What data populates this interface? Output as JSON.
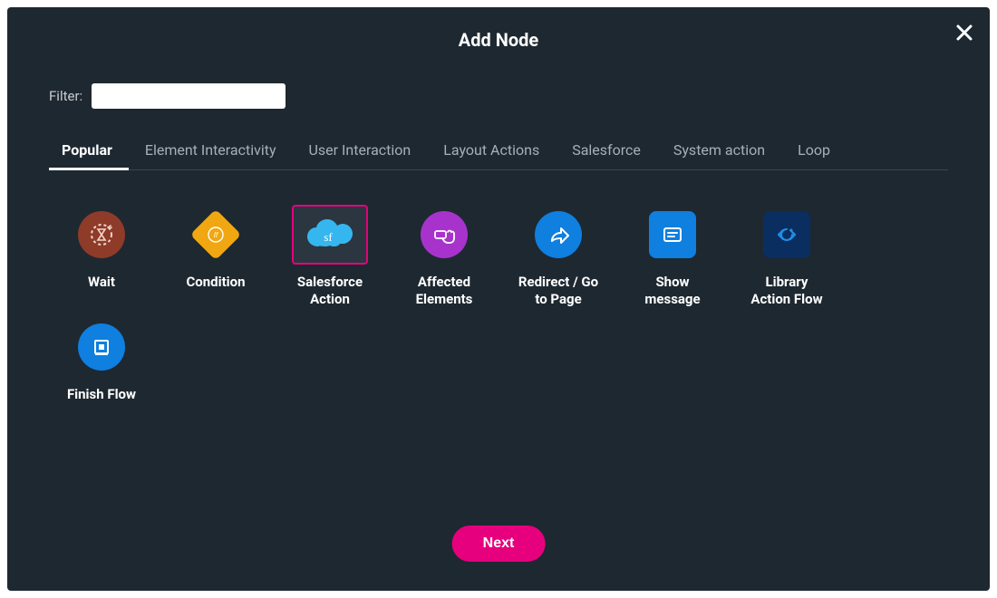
{
  "dialog": {
    "title": "Add Node",
    "filter_label": "Filter:",
    "filter_value": "",
    "filter_placeholder": ""
  },
  "tabs": [
    {
      "label": "Popular",
      "active": true
    },
    {
      "label": "Element Interactivity",
      "active": false
    },
    {
      "label": "User Interaction",
      "active": false
    },
    {
      "label": "Layout Actions",
      "active": false
    },
    {
      "label": "Salesforce",
      "active": false
    },
    {
      "label": "System action",
      "active": false
    },
    {
      "label": "Loop",
      "active": false
    }
  ],
  "nodes": [
    {
      "id": "wait",
      "label": "Wait",
      "selected": false,
      "shape": "circle",
      "bg": "#8e3b2a",
      "icon": "hourglass"
    },
    {
      "id": "condition",
      "label": "Condition",
      "selected": false,
      "shape": "diamond",
      "bg": "#f0a712",
      "icon": "if"
    },
    {
      "id": "salesforce-action",
      "label": "Salesforce\nAction",
      "selected": true,
      "shape": "cloud",
      "bg": "#1e9ee6",
      "icon": "sf"
    },
    {
      "id": "affected-elements",
      "label": "Affected\nElements",
      "selected": false,
      "shape": "circle",
      "bg": "#a733cc",
      "icon": "hand"
    },
    {
      "id": "redirect",
      "label": "Redirect / Go\nto Page",
      "selected": false,
      "shape": "circle",
      "bg": "#0f7fe0",
      "icon": "share"
    },
    {
      "id": "show-message",
      "label": "Show\nmessage",
      "selected": false,
      "shape": "square",
      "bg": "#0f7fe0",
      "icon": "message"
    },
    {
      "id": "library-action-flow",
      "label": "Library\nAction Flow",
      "selected": false,
      "shape": "square",
      "bg": "#0a2e60",
      "icon": "codeloop"
    },
    {
      "id": "finish-flow",
      "label": "Finish Flow",
      "selected": false,
      "shape": "circle",
      "bg": "#0f7fe0",
      "icon": "stop"
    }
  ],
  "footer": {
    "next_label": "Next"
  },
  "colors": {
    "dialog_bg": "#1e2831",
    "accent": "#e6007e"
  }
}
